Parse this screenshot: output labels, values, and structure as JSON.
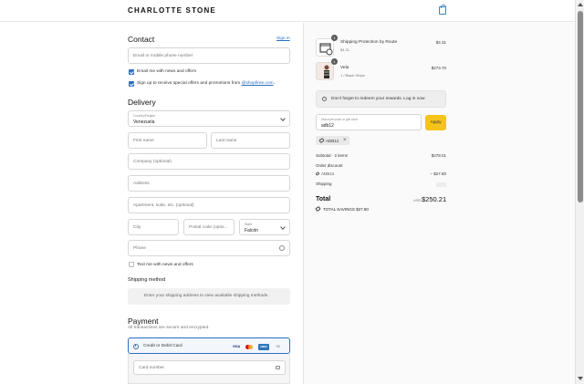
{
  "header": {
    "brand": "CHARLOTTE STONE",
    "cart_icon": "bag-icon"
  },
  "contact": {
    "title": "Contact",
    "sign_in": "Sign in",
    "email_placeholder": "Email or mobile phone number",
    "email_news": "Email me with news and offers",
    "signup_prefix": "Sign up to receive special offers and promotions from ",
    "signup_link": "@shopfiree.com",
    "signup_suffix": "."
  },
  "delivery": {
    "title": "Delivery",
    "country_label": "Country/Region",
    "country_value": "Venezuela",
    "first_name": "First name",
    "last_name": "Last name",
    "company": "Company (optional)",
    "address": "Address",
    "apartment": "Apartment, suite, etc. (optional)",
    "city": "City",
    "postal": "Postal code (optio…",
    "state_label": "State",
    "state_value": "Falcón",
    "phone": "Phone",
    "text_news": "Text me with news and offers"
  },
  "shipping_method": {
    "title": "Shipping method",
    "message": "Enter your shipping address to view available shipping methods."
  },
  "payment": {
    "title": "Payment",
    "subtitle": "All transactions are secure and encrypted.",
    "option": "Credit or Debit Card",
    "visa": "VISA",
    "amex": "AMEX",
    "more": "+5",
    "card_number": "Card number"
  },
  "summary": {
    "items": [
      {
        "name": "Shipping Protection by Route",
        "variant": "$4.31",
        "price": "$4.31",
        "qty": "1"
      },
      {
        "name": "Vela",
        "variant": "1 / Black Stripe",
        "price": "$273.70",
        "qty": "1"
      }
    ],
    "rewards_notice": "Don't forget to redeem your rewards. Log in now",
    "discount_label": "Discount code or gift card",
    "discount_value": "adb12",
    "apply": "Apply",
    "applied_code": "ADB12",
    "subtotal_label": "Subtotal · 2 items",
    "subtotal_value": "$278.01",
    "order_discount_label": "Order discount",
    "discount_code_label": "ADB12",
    "discount_amount": "− $27.80",
    "shipping_label": "Shipping",
    "shipping_value": "",
    "total_label": "Total",
    "currency": "USD",
    "total_value": "$250.21",
    "savings_label": "TOTAL SAVINGS",
    "savings_value": "$27.80"
  },
  "colors": {
    "accent": "#2f6fbf",
    "apply": "#f6c31b"
  }
}
